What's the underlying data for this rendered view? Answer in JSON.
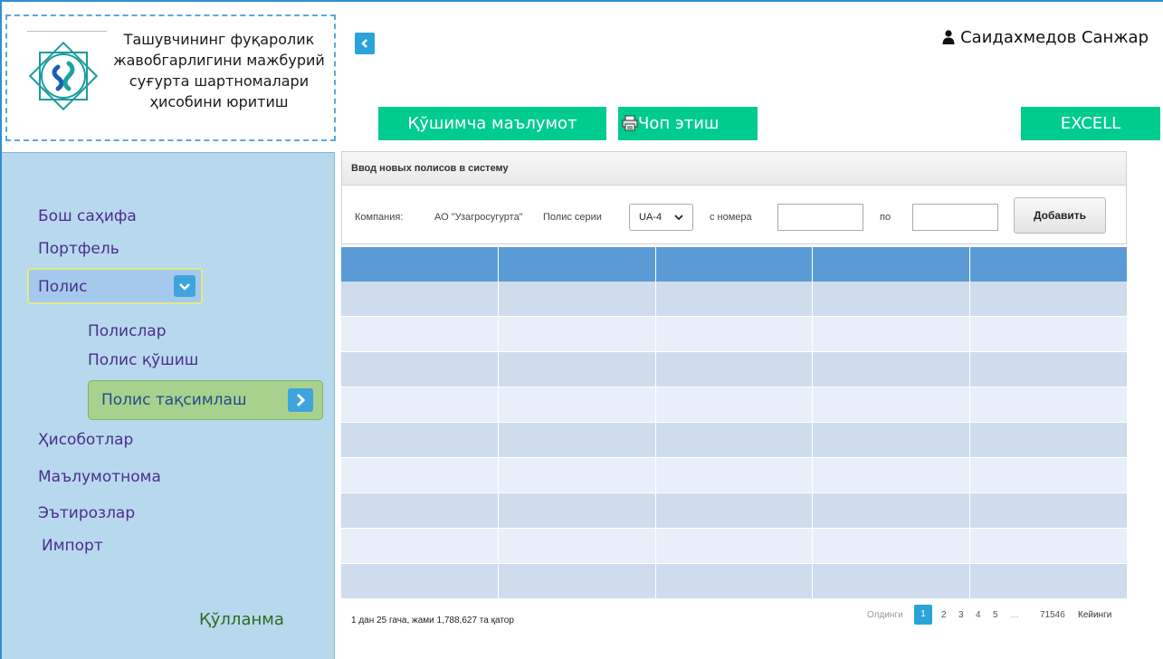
{
  "logo": {
    "text_lines": [
      "Ташувчининг фуқаролик",
      "жавобгарлигини мажбурий",
      "суғурта шартномалари",
      "ҳисобини юритиш"
    ]
  },
  "header": {
    "user_name": "Саидахмедов Санжар"
  },
  "toolbar": {
    "extra_info": "Қўшимча маълумот",
    "print": "Чоп этиш",
    "excel": "EXCELL"
  },
  "sidebar": {
    "items": [
      {
        "label": "Бош саҳифа"
      },
      {
        "label": "Портфель"
      },
      {
        "label": "Полис"
      },
      {
        "label": "Полислар"
      },
      {
        "label": "Полис қўшиш"
      },
      {
        "label": "Полис тақсимлаш"
      },
      {
        "label": "Ҳисоботлар"
      },
      {
        "label": "Маълумотнома"
      },
      {
        "label": "Эътирозлар"
      },
      {
        "label": "Импорт"
      }
    ],
    "manual": "Қўлланма"
  },
  "panel": {
    "title": "Ввод новых полисов в систему",
    "company_label": "Компания:",
    "company_value": "АО \"Узагросугурта\"",
    "series_label": "Полис серии",
    "series_value": "UA-4",
    "from_label": "с номера",
    "from_value": "",
    "to_label": "по",
    "to_value": "",
    "add_button": "Добавить"
  },
  "table": {
    "columns": 5,
    "rows": 9
  },
  "footer": {
    "info": "1 дан 25 гача, жами 1,788,627 та қатор",
    "prev": "Олдинги",
    "pages": [
      "1",
      "2",
      "3",
      "4",
      "5",
      "…",
      "71546"
    ],
    "next": "Кейинги"
  },
  "colors": {
    "accent_green": "#00cc8f",
    "sidebar_bg": "#b8d8ee",
    "table_header": "#5b9bd5",
    "row_dark": "#cfdcee",
    "row_light": "#e8eff8",
    "nav_text": "#4b2e8c"
  }
}
